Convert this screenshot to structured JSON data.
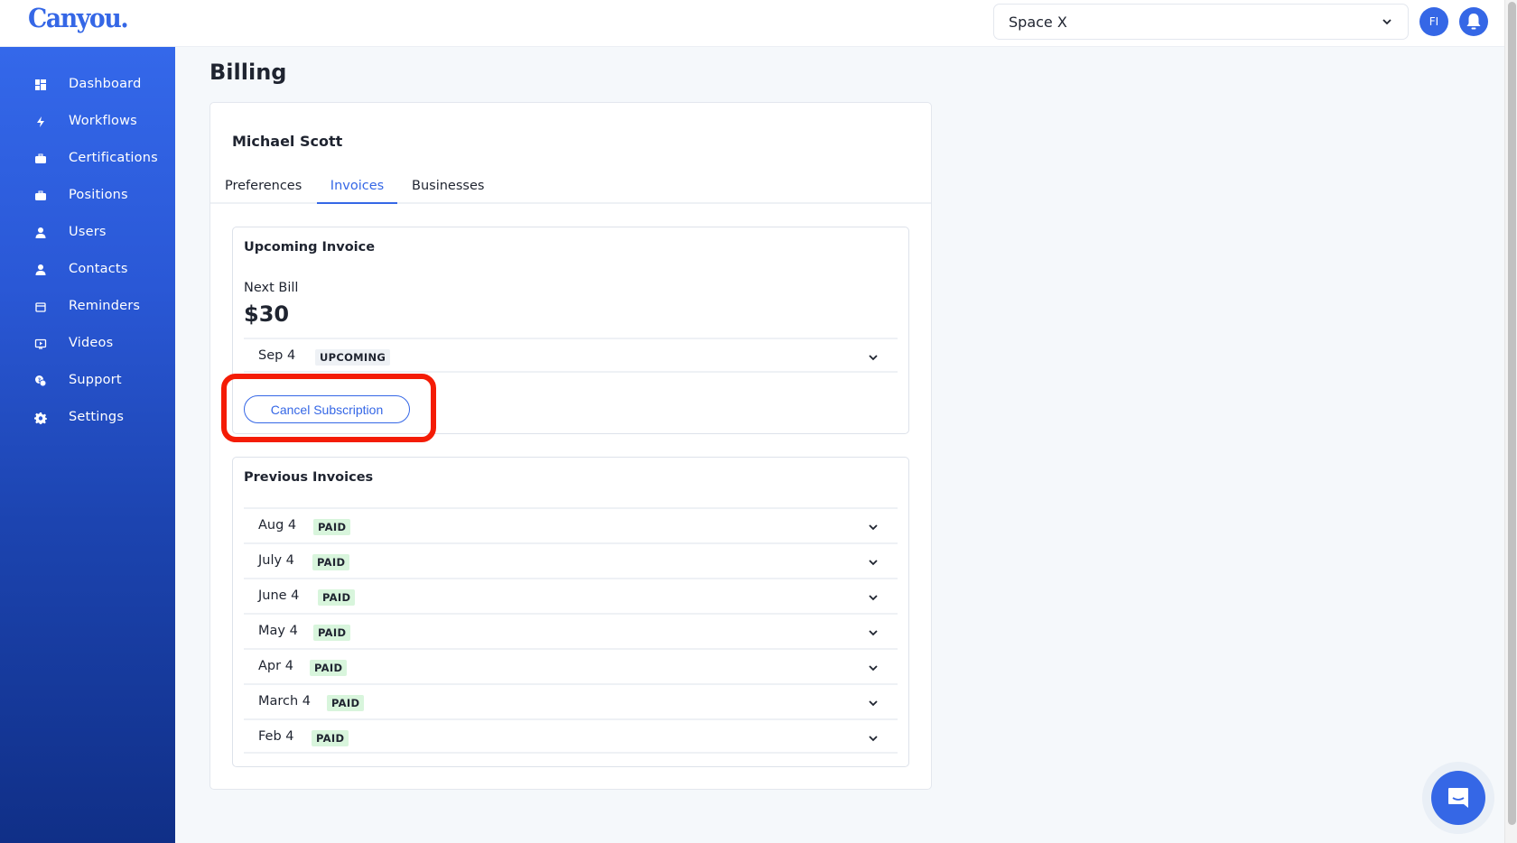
{
  "app": {
    "logo": "Canyou.",
    "workspace": "Space X",
    "avatar_initials": "FI"
  },
  "sidebar": {
    "items": [
      {
        "label": "Dashboard",
        "icon": "dashboard-icon"
      },
      {
        "label": "Workflows",
        "icon": "lightning-icon"
      },
      {
        "label": "Certifications",
        "icon": "briefcase-icon"
      },
      {
        "label": "Positions",
        "icon": "briefcase-icon"
      },
      {
        "label": "Users",
        "icon": "user-icon"
      },
      {
        "label": "Contacts",
        "icon": "user-icon"
      },
      {
        "label": "Reminders",
        "icon": "calendar-icon"
      },
      {
        "label": "Videos",
        "icon": "video-icon"
      },
      {
        "label": "Support",
        "icon": "support-chat-icon"
      },
      {
        "label": "Settings",
        "icon": "gear-icon"
      }
    ]
  },
  "page": {
    "title": "Billing",
    "user_name": "Michael Scott",
    "tabs": [
      {
        "label": "Preferences",
        "active": false
      },
      {
        "label": "Invoices",
        "active": true
      },
      {
        "label": "Businesses",
        "active": false
      }
    ]
  },
  "upcoming": {
    "title": "Upcoming Invoice",
    "next_bill_label": "Next Bill",
    "amount": "$30",
    "date": "Sep 4",
    "status": "UPCOMING",
    "cancel_label": "Cancel Subscription"
  },
  "previous": {
    "title": "Previous Invoices",
    "invoices": [
      {
        "date": "Aug 4",
        "status": "PAID"
      },
      {
        "date": "July 4",
        "status": "PAID"
      },
      {
        "date": "June 4",
        "status": "PAID"
      },
      {
        "date": "May 4",
        "status": "PAID"
      },
      {
        "date": "Apr 4",
        "status": "PAID"
      },
      {
        "date": "March 4",
        "status": "PAID"
      },
      {
        "date": "Feb 4",
        "status": "PAID"
      }
    ]
  },
  "colors": {
    "accent": "#3567e6",
    "paid_badge": "#d8f5dc",
    "highlight": "#f41c06"
  }
}
